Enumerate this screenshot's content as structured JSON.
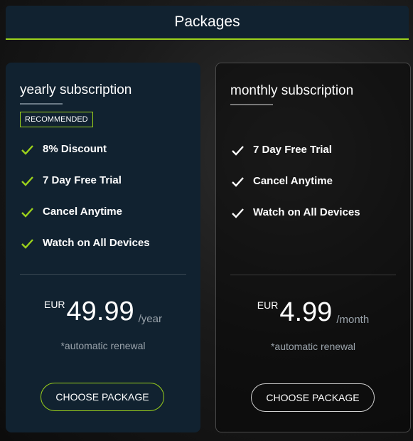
{
  "header": {
    "title": "Packages"
  },
  "colors": {
    "accent": "#9bd11b",
    "card_bg": "#112230",
    "muted_text": "#9aa3ab"
  },
  "plans": [
    {
      "name": "yearly subscription",
      "badge": "RECOMMENDED",
      "features": [
        "8% Discount",
        "7 Day Free Trial",
        "Cancel Anytime",
        "Watch on All Devices"
      ],
      "currency": "EUR",
      "amount": "49.99",
      "period": "/year",
      "renewal_note": "*automatic renewal",
      "button_label": "CHOOSE PACKAGE",
      "icon": "check-icon"
    },
    {
      "name": "monthly subscription",
      "features": [
        "7 Day Free Trial",
        "Cancel Anytime",
        "Watch on All Devices"
      ],
      "currency": "EUR",
      "amount": "4.99",
      "period": "/month",
      "renewal_note": "*automatic renewal",
      "button_label": "CHOOSE PACKAGE",
      "icon": "check-icon"
    }
  ]
}
